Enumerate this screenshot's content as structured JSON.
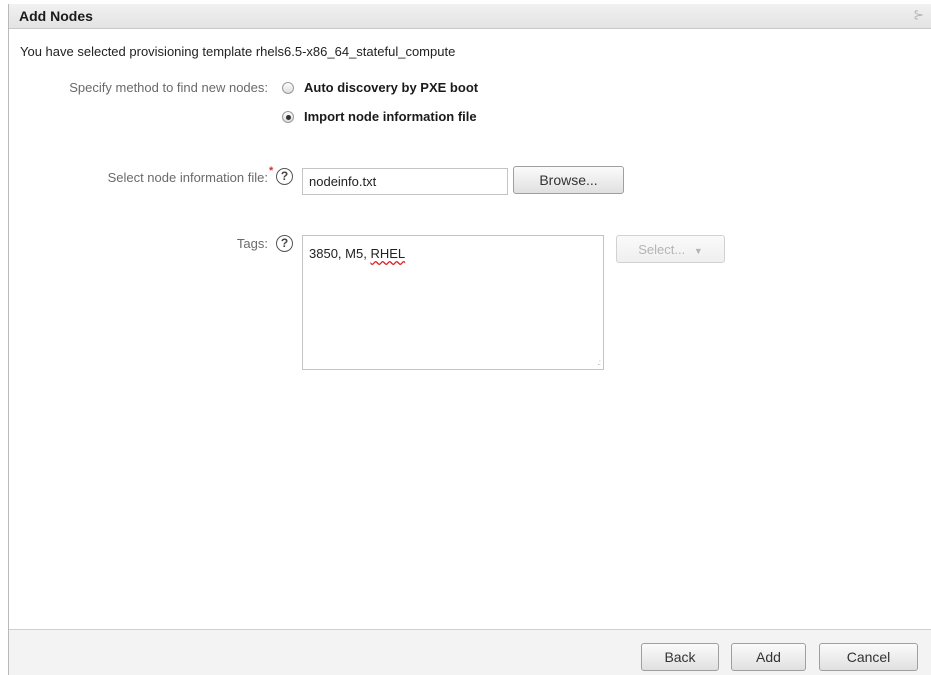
{
  "dialog": {
    "title": "Add Nodes",
    "close_icon": "close-icon"
  },
  "intro_text": "You have selected provisioning template rhels6.5-x86_64_stateful_compute",
  "method": {
    "label": "Specify method to find new nodes:",
    "options": [
      {
        "label": "Auto discovery by PXE boot",
        "selected": false
      },
      {
        "label": "Import node information file",
        "selected": true
      }
    ]
  },
  "node_file": {
    "label": "Select node information file:",
    "required_mark": "*",
    "help_glyph": "?",
    "value": "nodeinfo.txt",
    "browse_label": "Browse..."
  },
  "tags": {
    "label": "Tags:",
    "help_glyph": "?",
    "value_prefix": "3850, M5, ",
    "value_misspelled": "RHEL",
    "select_label": "Select...",
    "select_enabled": false
  },
  "footer": {
    "back_label": "Back",
    "add_label": "Add",
    "cancel_label": "Cancel"
  }
}
